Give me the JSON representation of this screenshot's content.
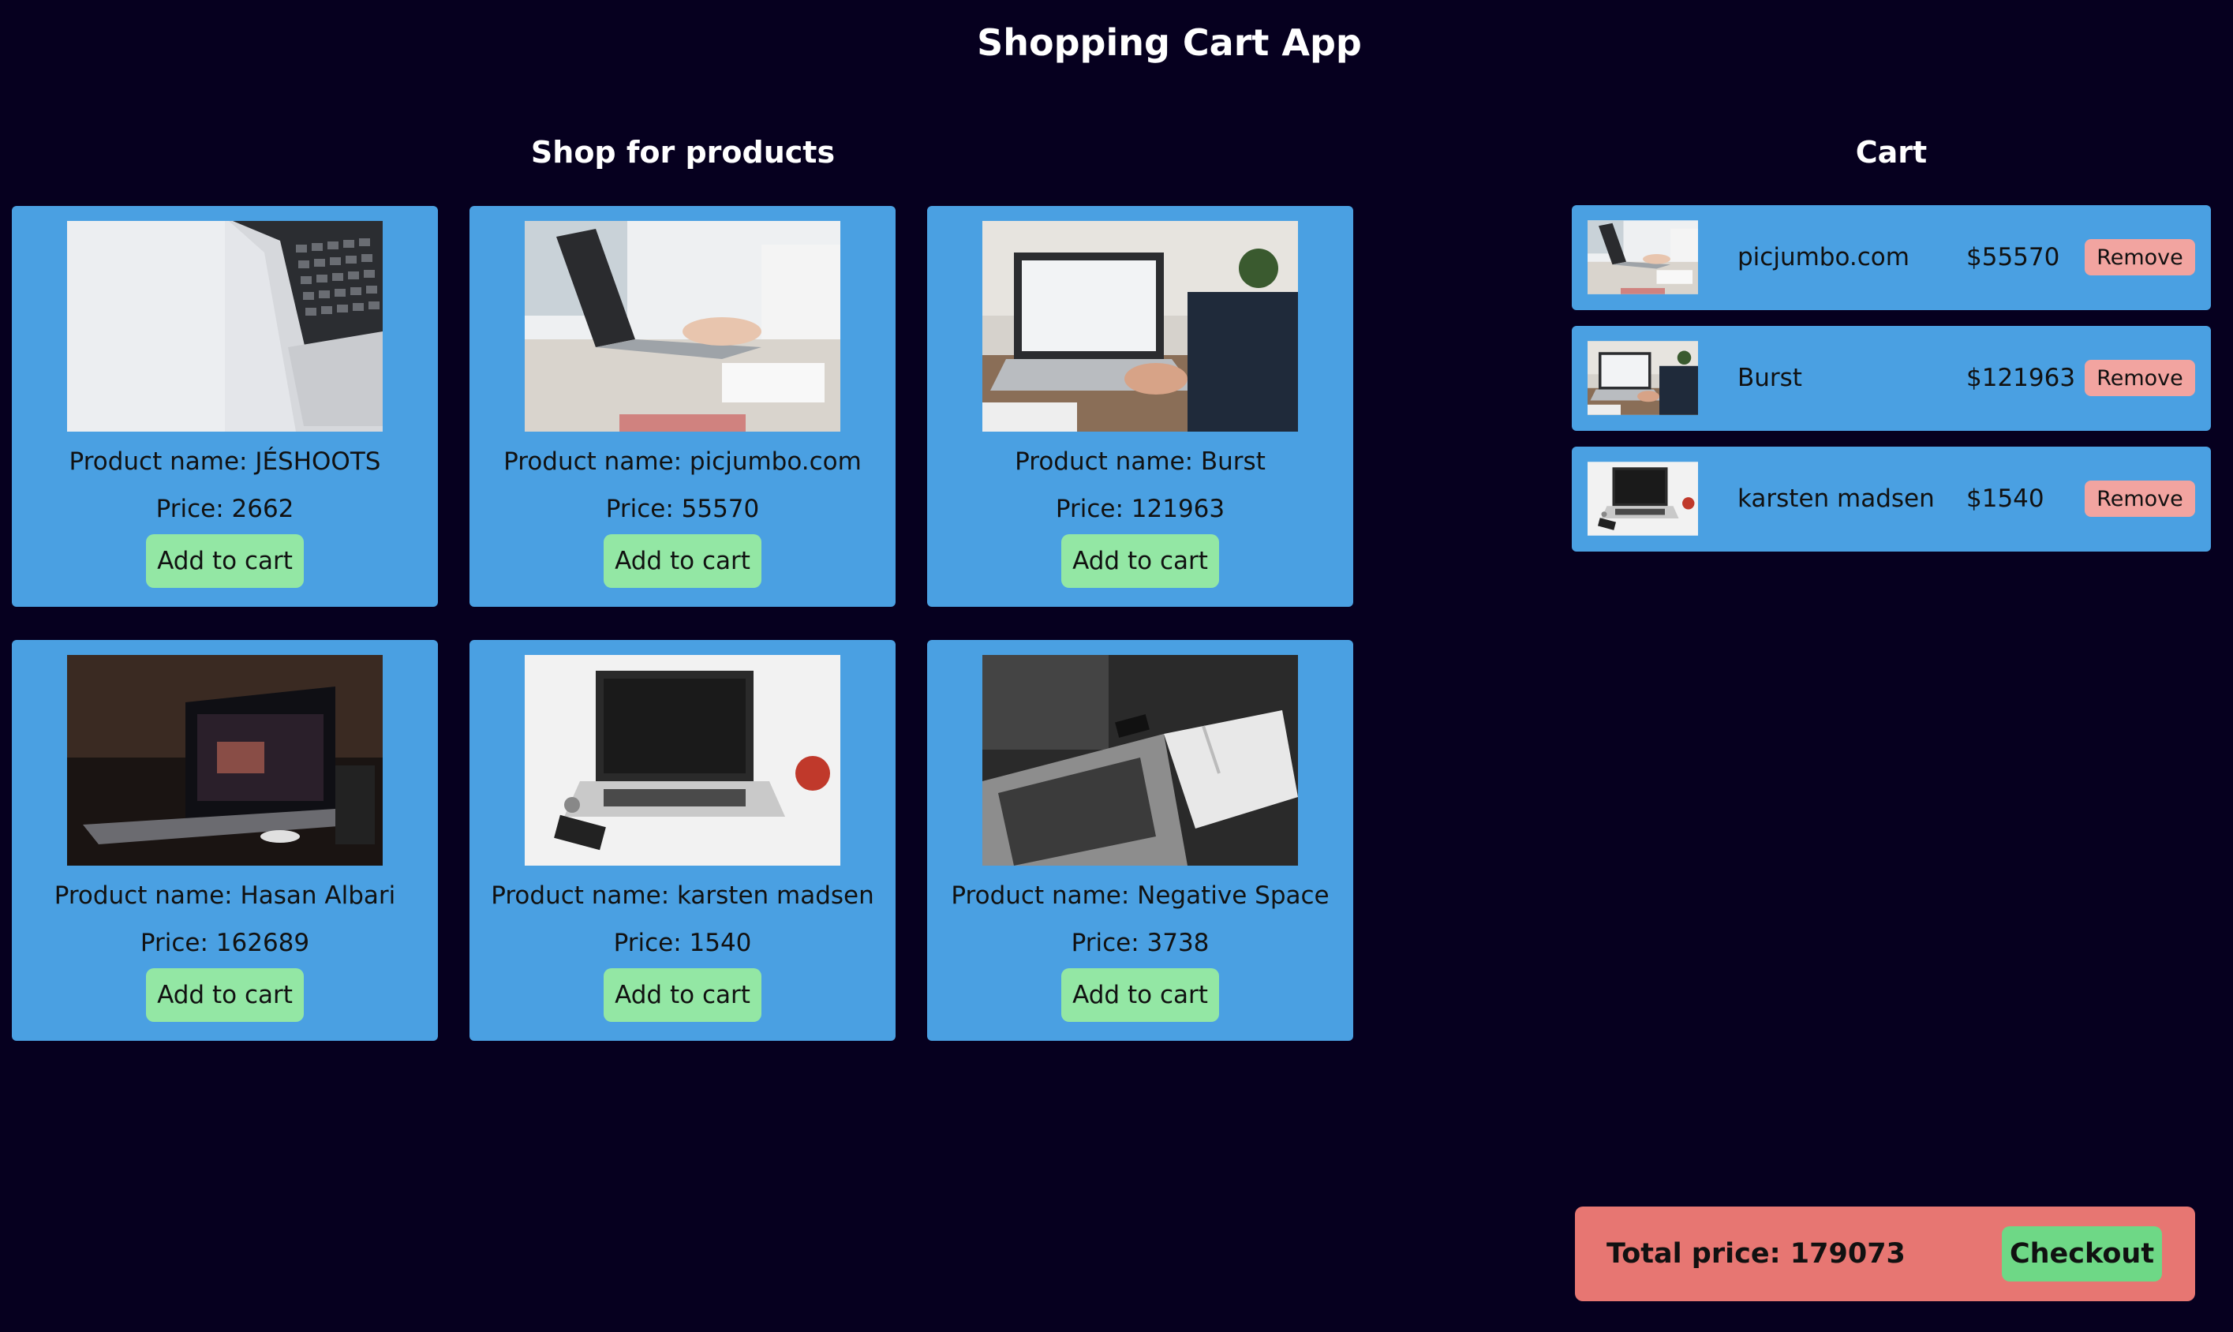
{
  "app": {
    "title": "Shopping Cart App"
  },
  "shop": {
    "title": "Shop for products",
    "products": [
      {
        "name": "Product name: JÉSHOOTS",
        "price": "Price: 2662",
        "button": "Add to cart",
        "image": "laptop-keyboard-closeup-photo"
      },
      {
        "name": "Product name: picjumbo.com",
        "price": "Price: 55570",
        "button": "Add to cart",
        "image": "hands-typing-laptop-photo"
      },
      {
        "name": "Product name: Burst",
        "price": "Price: 121963",
        "button": "Add to cart",
        "image": "person-using-laptop-desk-photo"
      },
      {
        "name": "Product name: Hasan Albari",
        "price": "Price: 162689",
        "button": "Add to cart",
        "image": "dark-laptop-desk-photo"
      },
      {
        "name": "Product name: karsten madsen",
        "price": "Price: 1540",
        "button": "Add to cart",
        "image": "laptop-apple-phone-photo"
      },
      {
        "name": "Product name: Negative Space",
        "price": "Price: 3738",
        "button": "Add to cart",
        "image": "laptop-notebook-phone-bw-photo"
      }
    ]
  },
  "cart": {
    "title": "Cart",
    "items": [
      {
        "name": "picjumbo.com",
        "price": "$55570",
        "button": "Remove"
      },
      {
        "name": "Burst",
        "price": "$121963",
        "button": "Remove"
      },
      {
        "name": "karsten madsen",
        "price": "$1540",
        "button": "Remove"
      }
    ],
    "total_label": "Total price: 179073",
    "checkout_label": "Checkout"
  },
  "colors": {
    "background": "#06001f",
    "card": "#4aa0e2",
    "add_button": "#93e7a4",
    "remove_button": "#f2a4a0",
    "total_box": "#e77672",
    "checkout_button": "#6ed886"
  }
}
